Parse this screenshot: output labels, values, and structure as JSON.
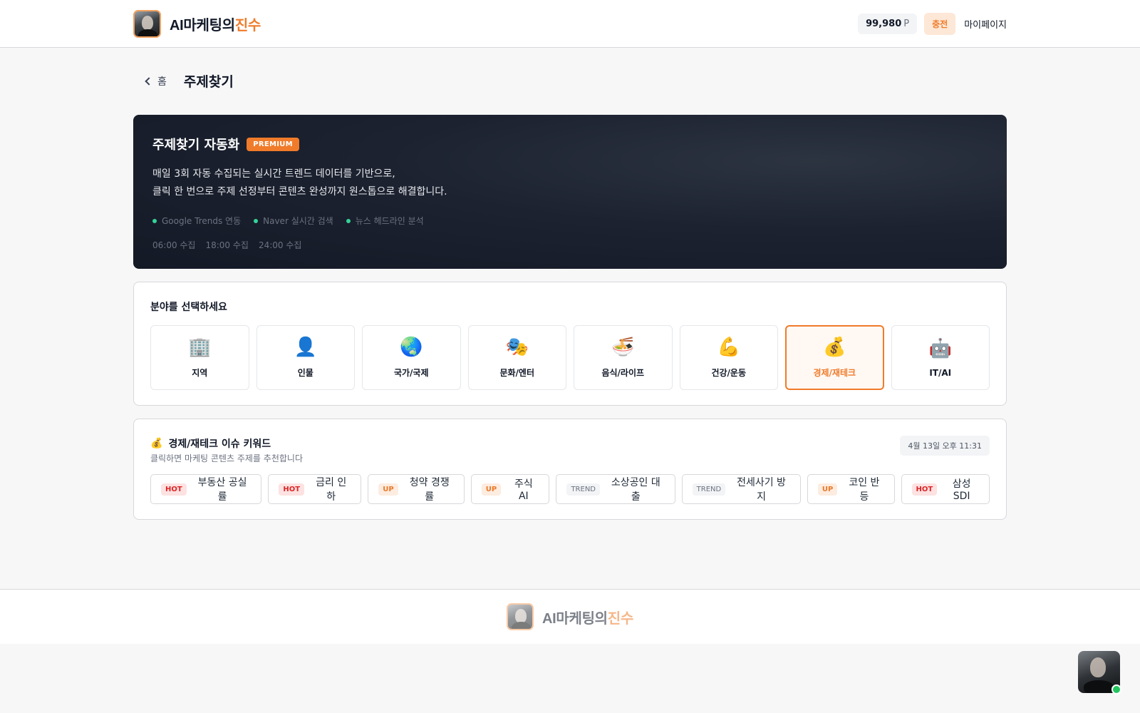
{
  "header": {
    "brand_dark": "AI마케팅의",
    "brand_accent": "진수",
    "points_value": "99,980",
    "points_unit": "P",
    "charge_label": "충전",
    "mypage_label": "마이페이지"
  },
  "nav": {
    "back_label": "홈",
    "page_title": "주제찾기"
  },
  "hero": {
    "title": "주제찾기 자동화",
    "badge": "PREMIUM",
    "desc_line1": "매일 3회 자동 수집되는 실시간 트렌드 데이터를 기반으로,",
    "desc_line2": "클릭 한 번으로 주제 선정부터 콘텐츠 완성까지 원스톱으로 해결합니다.",
    "sources": [
      "Google Trends 연동",
      "Naver 실시간 검색",
      "뉴스 헤드라인 분석"
    ],
    "times": [
      "06:00 수집",
      "18:00 수집",
      "24:00 수집"
    ]
  },
  "categories": {
    "title": "분야를 선택하세요",
    "selected": "경제/재테크",
    "items": [
      {
        "icon": "🏢",
        "icon_name": "office-building-icon",
        "label": "지역"
      },
      {
        "icon": "👤",
        "icon_name": "person-icon",
        "label": "인물"
      },
      {
        "icon": "🌏",
        "icon_name": "globe-icon",
        "label": "국가/국제"
      },
      {
        "icon": "🎭",
        "icon_name": "theater-masks-icon",
        "label": "문화/엔터"
      },
      {
        "icon": "🍜",
        "icon_name": "noodle-bowl-icon",
        "label": "음식/라이프"
      },
      {
        "icon": "💪",
        "icon_name": "flexed-arm-icon",
        "label": "건강/운동"
      },
      {
        "icon": "💰",
        "icon_name": "money-bag-icon",
        "label": "경제/재테크"
      },
      {
        "icon": "🤖",
        "icon_name": "robot-icon",
        "label": "IT/AI"
      }
    ]
  },
  "keywords": {
    "icon": "💰",
    "icon_name": "money-bag-icon",
    "title": "경제/재테크 이슈 키워드",
    "subtitle": "클릭하면 마케팅 콘텐츠 주제를 추천합니다",
    "updated": "4월 13일 오후 11:31",
    "items": [
      {
        "badge": "HOT",
        "text": "부동산 공실률"
      },
      {
        "badge": "HOT",
        "text": "금리 인하"
      },
      {
        "badge": "UP",
        "text": "청약 경쟁률"
      },
      {
        "badge": "UP",
        "text": "주식 AI"
      },
      {
        "badge": "TREND",
        "text": "소상공인 대출"
      },
      {
        "badge": "TREND",
        "text": "전세사기 방지"
      },
      {
        "badge": "UP",
        "text": "코인 반등"
      },
      {
        "badge": "HOT",
        "text": "삼성SDI"
      }
    ]
  },
  "footer": {
    "brand_dark": "AI마케팅의",
    "brand_accent": "진수"
  },
  "colors": {
    "accent": "#f07b2a",
    "hero_bg": "#1c2230",
    "online": "#22c55e"
  }
}
